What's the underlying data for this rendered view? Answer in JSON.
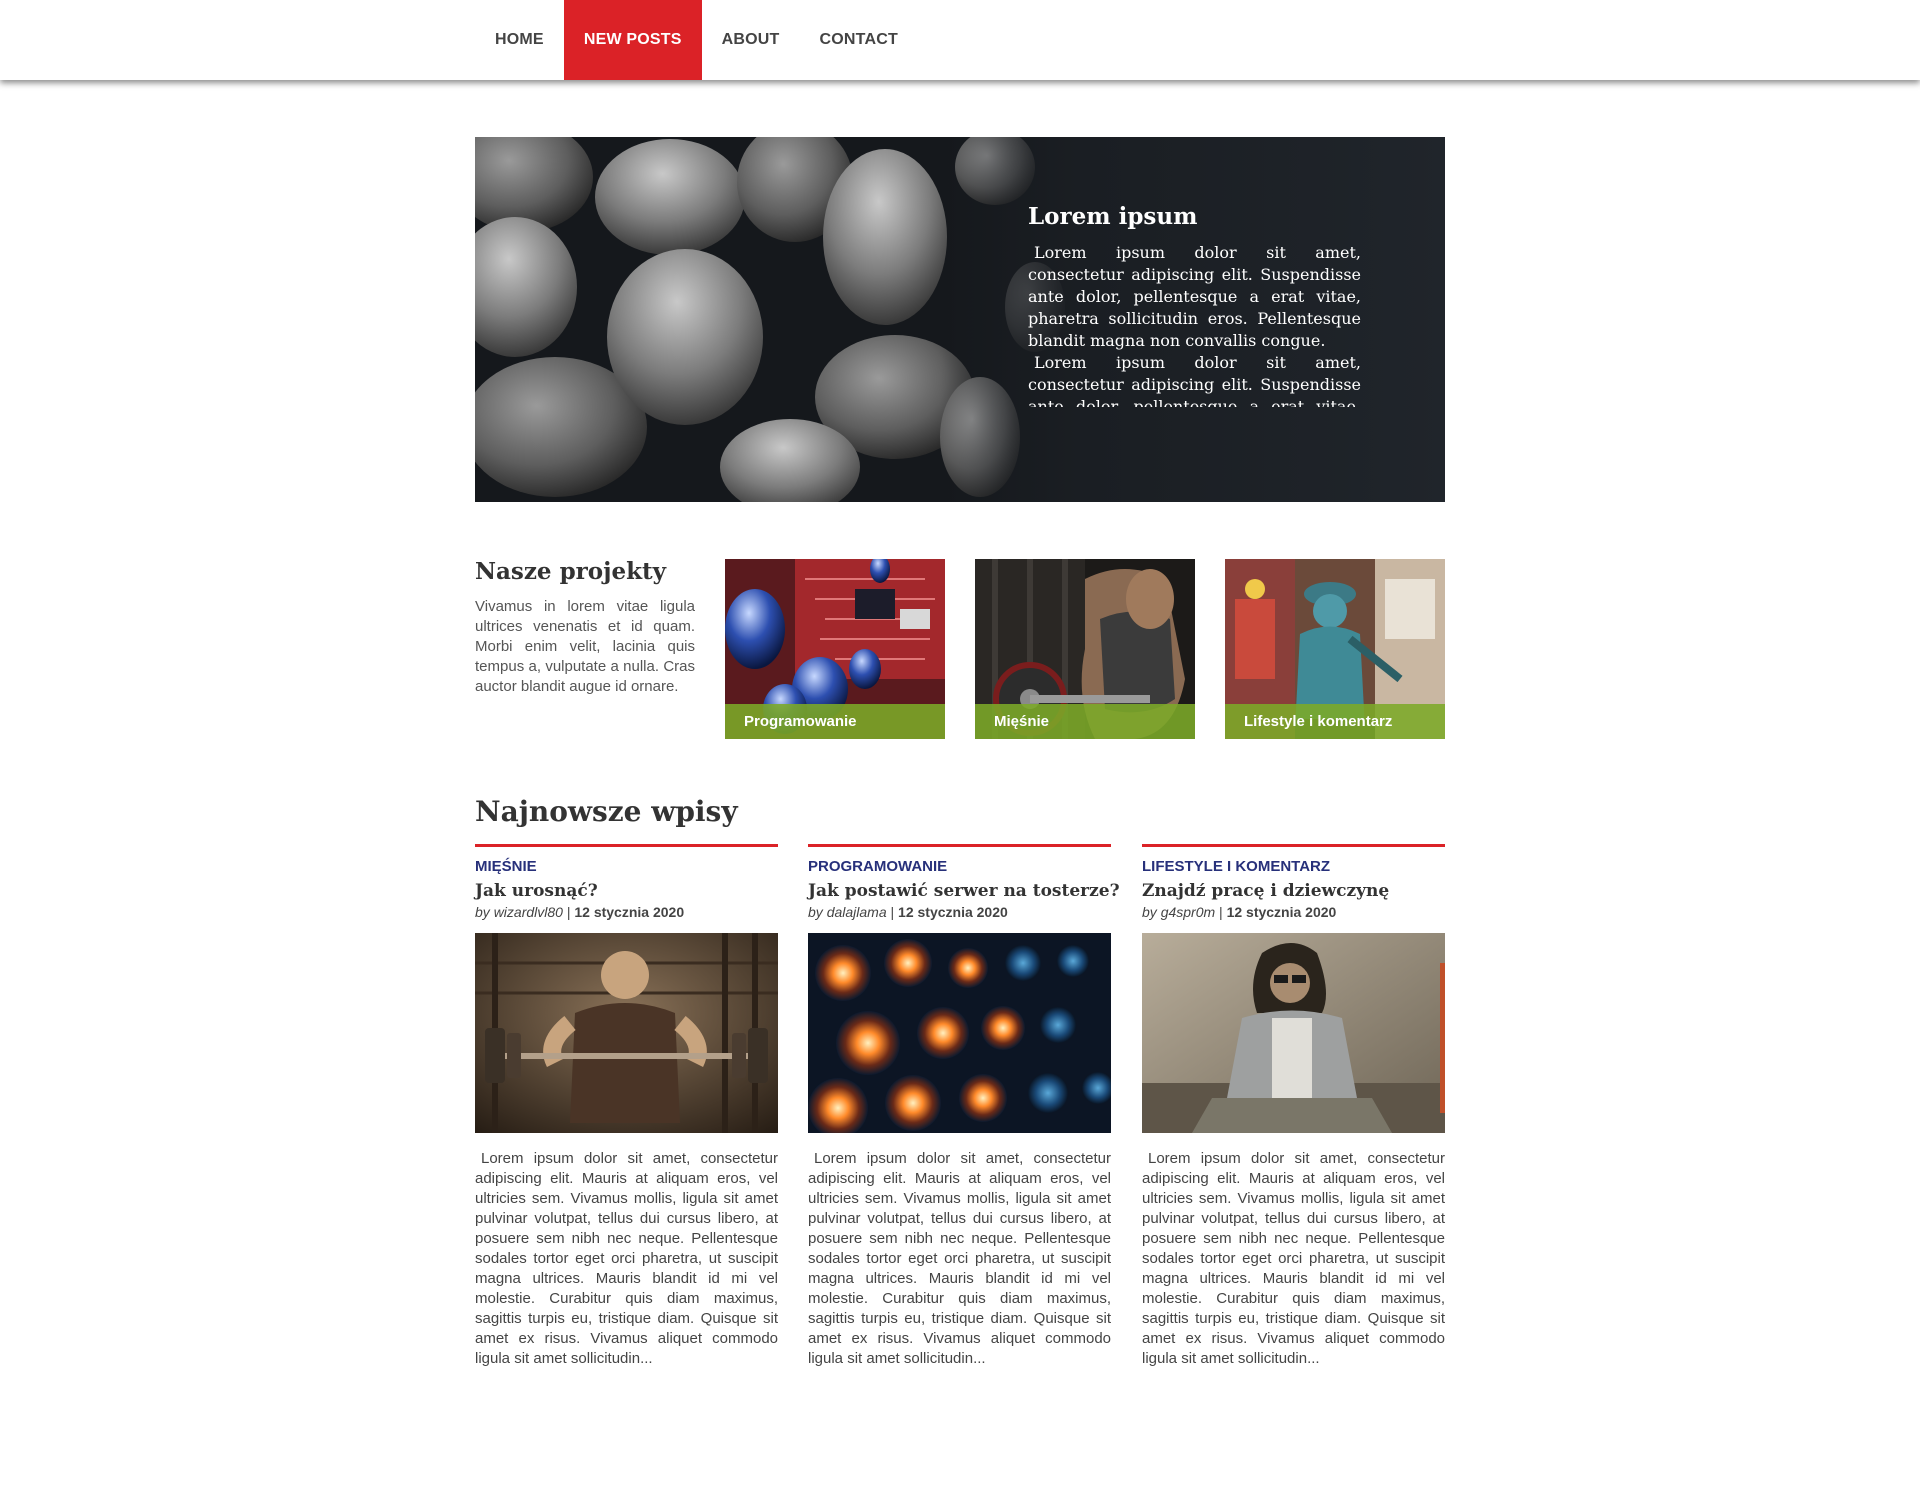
{
  "nav": {
    "items": [
      {
        "label": "HOME"
      },
      {
        "label": "NEW POSTS"
      },
      {
        "label": "ABOUT"
      },
      {
        "label": "CONTACT"
      }
    ],
    "active_index": 1
  },
  "hero": {
    "title": "Lorem ipsum",
    "paragraphs": [
      "Lorem ipsum dolor sit amet, consectetur adipiscing elit. Suspendisse ante dolor, pellentesque a erat vitae, pharetra sollicitudin eros. Pellentesque blandit magna non convallis congue.",
      "Lorem ipsum dolor sit amet, consectetur adipiscing elit. Suspendisse ante dolor, pellentesque a erat vitae, pharetra"
    ]
  },
  "projects": {
    "title": "Nasze projekty",
    "description": "Vivamus in lorem vitae ligula ultrices venenatis et id quam. Morbi enim velit, lacinia quis tempus a, vulputate a nulla. Cras auctor blandit augue id ornare.",
    "cards": [
      {
        "label": "Programowanie"
      },
      {
        "label": "Mięśnie"
      },
      {
        "label": "Lifestyle i komentarz"
      }
    ]
  },
  "latest": {
    "title": "Najnowsze wpisy",
    "by_prefix": "by",
    "posts": [
      {
        "category": "MIĘŚNIE",
        "title": "Jak urosnąć?",
        "author": "wizardlvl80",
        "date": "12 stycznia 2020",
        "excerpt": "Lorem ipsum dolor sit amet, consectetur adipiscing elit. Mauris at aliquam eros, vel ultricies sem. Vivamus mollis, ligula sit amet pulvinar volutpat, tellus dui cursus libero, at posuere sem nibh nec neque. Pellentesque sodales tortor eget orci pharetra, ut suscipit magna ultrices. Mauris blandit id mi vel molestie. Curabitur quis diam maximus, sagittis turpis eu, tristique diam. Quisque sit amet ex risus. Vivamus aliquet commodo ligula sit amet sollicitudin..."
      },
      {
        "category": "PROGRAMOWANIE",
        "title": "Jak postawić serwer na tosterze?",
        "author": "dalajlama",
        "date": "12 stycznia 2020",
        "excerpt": "Lorem ipsum dolor sit amet, consectetur adipiscing elit. Mauris at aliquam eros, vel ultricies sem. Vivamus mollis, ligula sit amet pulvinar volutpat, tellus dui cursus libero, at posuere sem nibh nec neque. Pellentesque sodales tortor eget orci pharetra, ut suscipit magna ultrices. Mauris blandit id mi vel molestie. Curabitur quis diam maximus, sagittis turpis eu, tristique diam. Quisque sit amet ex risus. Vivamus aliquet commodo ligula sit amet sollicitudin..."
      },
      {
        "category": "LIFESTYLE I KOMENTARZ",
        "title": "Znajdź pracę i dziewczynę",
        "author": "g4spr0m",
        "date": "12 stycznia 2020",
        "excerpt": "Lorem ipsum dolor sit amet, consectetur adipiscing elit. Mauris at aliquam eros, vel ultricies sem. Vivamus mollis, ligula sit amet pulvinar volutpat, tellus dui cursus libero, at posuere sem nibh nec neque. Pellentesque sodales tortor eget orci pharetra, ut suscipit magna ultrices. Mauris blandit id mi vel molestie. Curabitur quis diam maximus, sagittis turpis eu, tristique diam. Quisque sit amet ex risus. Vivamus aliquet commodo ligula sit amet sollicitudin..."
      }
    ]
  },
  "colors": {
    "accent": "#db2227",
    "category": "#27307a",
    "project_label_bg": "#7caa28",
    "hero_bg": "#1b1f24"
  }
}
